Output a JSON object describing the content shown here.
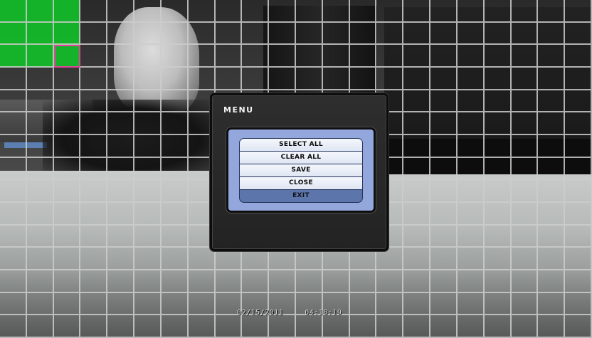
{
  "menu": {
    "title": "MENU",
    "items": [
      {
        "label": "SELECT ALL",
        "selected": false
      },
      {
        "label": "CLEAR ALL",
        "selected": false
      },
      {
        "label": "SAVE",
        "selected": false
      },
      {
        "label": "CLOSE",
        "selected": false
      },
      {
        "label": "EXIT",
        "selected": true
      }
    ]
  },
  "overlay": {
    "date": "02/15/2011",
    "time": "04:18:19"
  },
  "motion_grid": {
    "columns": 22,
    "rows": 15,
    "active_cells": [
      [
        0,
        0
      ],
      [
        1,
        0
      ],
      [
        2,
        0
      ],
      [
        0,
        1
      ],
      [
        1,
        1
      ],
      [
        2,
        1
      ],
      [
        0,
        2
      ],
      [
        1,
        2
      ],
      [
        2,
        2
      ]
    ],
    "cursor_cell": [
      2,
      2
    ]
  },
  "colors": {
    "active_cell": "#12be28",
    "cursor": "#e0469a",
    "menu_frame": "#93a7dc",
    "menu_selected": "#5c76ac"
  }
}
